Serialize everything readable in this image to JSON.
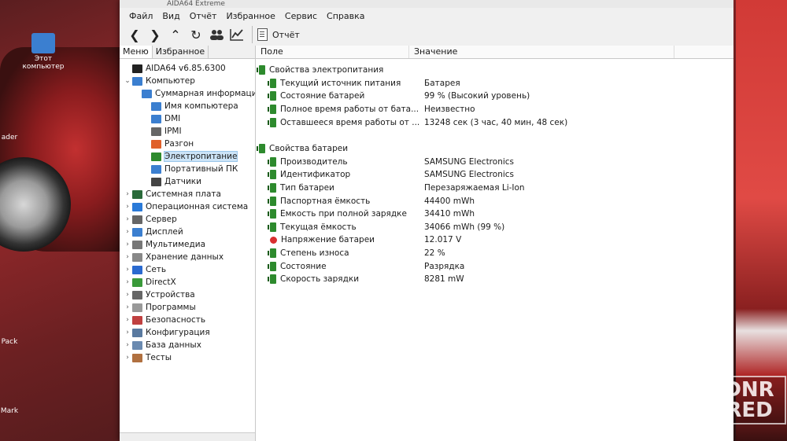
{
  "window": {
    "title": "AIDA64 Extreme",
    "menu": [
      "Файл",
      "Вид",
      "Отчёт",
      "Избранное",
      "Сервис",
      "Справка"
    ],
    "toolbar": {
      "report_label": "Отчёт"
    }
  },
  "left_panel": {
    "tabs": [
      "Меню",
      "Избранное"
    ],
    "tree": [
      {
        "label": "AIDA64 v6.85.6300",
        "icon": "aida64-icon",
        "level": 0,
        "exp": ""
      },
      {
        "label": "Компьютер",
        "icon": "computer-icon",
        "level": 0,
        "exp": "v"
      },
      {
        "label": "Суммарная информация",
        "icon": "monitor-icon",
        "level": 1,
        "exp": ""
      },
      {
        "label": "Имя компьютера",
        "icon": "monitor-icon",
        "level": 1,
        "exp": ""
      },
      {
        "label": "DMI",
        "icon": "monitor-icon",
        "level": 1,
        "exp": ""
      },
      {
        "label": "IPMI",
        "icon": "server-icon",
        "level": 1,
        "exp": ""
      },
      {
        "label": "Разгон",
        "icon": "flame-icon",
        "level": 1,
        "exp": ""
      },
      {
        "label": "Электропитание",
        "icon": "power-icon",
        "level": 1,
        "exp": "",
        "selected": true
      },
      {
        "label": "Портативный ПК",
        "icon": "laptop-icon",
        "level": 1,
        "exp": ""
      },
      {
        "label": "Датчики",
        "icon": "gauge-icon",
        "level": 1,
        "exp": ""
      },
      {
        "label": "Системная плата",
        "icon": "motherboard-icon",
        "level": 0,
        "exp": ">"
      },
      {
        "label": "Операционная система",
        "icon": "windows-icon",
        "level": 0,
        "exp": ">"
      },
      {
        "label": "Сервер",
        "icon": "server-icon",
        "level": 0,
        "exp": ">"
      },
      {
        "label": "Дисплей",
        "icon": "display-icon",
        "level": 0,
        "exp": ">"
      },
      {
        "label": "Мультимедиа",
        "icon": "speaker-icon",
        "level": 0,
        "exp": ">"
      },
      {
        "label": "Хранение данных",
        "icon": "storage-icon",
        "level": 0,
        "exp": ">"
      },
      {
        "label": "Сеть",
        "icon": "network-icon",
        "level": 0,
        "exp": ">"
      },
      {
        "label": "DirectX",
        "icon": "directx-icon",
        "level": 0,
        "exp": ">"
      },
      {
        "label": "Устройства",
        "icon": "devices-icon",
        "level": 0,
        "exp": ">"
      },
      {
        "label": "Программы",
        "icon": "programs-icon",
        "level": 0,
        "exp": ">"
      },
      {
        "label": "Безопасность",
        "icon": "shield-icon",
        "level": 0,
        "exp": ">"
      },
      {
        "label": "Конфигурация",
        "icon": "config-icon",
        "level": 0,
        "exp": ">"
      },
      {
        "label": "База данных",
        "icon": "database-icon",
        "level": 0,
        "exp": ">"
      },
      {
        "label": "Тесты",
        "icon": "tests-icon",
        "level": 0,
        "exp": ">"
      }
    ]
  },
  "right_panel": {
    "columns": [
      "Поле",
      "Значение"
    ],
    "sections": [
      {
        "title": "Свойства электропитания",
        "items": [
          {
            "field": "Текущий источник питания",
            "value": "Батарея",
            "icon": "plug-icon"
          },
          {
            "field": "Состояние батарей",
            "value": "99 % (Высокий уровень)",
            "icon": "plug-icon"
          },
          {
            "field": "Полное время работы от бата...",
            "value": "Неизвестно",
            "icon": "plug-icon"
          },
          {
            "field": "Оставшееся время работы от ...",
            "value": "13248 сек (3 час, 40 мин, 48 сек)",
            "icon": "plug-icon"
          }
        ]
      },
      {
        "title": "Свойства батареи",
        "items": [
          {
            "field": "Производитель",
            "value": "SAMSUNG Electronics",
            "icon": "plug-icon"
          },
          {
            "field": "Идентификатор",
            "value": "SAMSUNG Electronics",
            "icon": "plug-icon"
          },
          {
            "field": "Тип батареи",
            "value": "Перезаряжаемая Li-Ion",
            "icon": "plug-icon"
          },
          {
            "field": "Паспортная ёмкость",
            "value": "44400 mWh",
            "icon": "plug-icon"
          },
          {
            "field": "Ёмкость при полной зарядке",
            "value": "34410 mWh",
            "icon": "plug-icon"
          },
          {
            "field": "Текущая ёмкость",
            "value": "34066 mWh  (99 %)",
            "icon": "plug-icon"
          },
          {
            "field": "Напряжение батареи",
            "value": "12.017 V",
            "icon": "voltage-icon"
          },
          {
            "field": "Степень износа",
            "value": "22 %",
            "icon": "plug-icon"
          },
          {
            "field": "Состояние",
            "value": "Разрядка",
            "icon": "plug-icon"
          },
          {
            "field": "Скорость зарядки",
            "value": "8281 mW",
            "icon": "plug-icon"
          }
        ]
      }
    ]
  },
  "desktop": {
    "icons": [
      "Этот компьютер",
      "ader",
      "Pack",
      "Mark"
    ],
    "watermark": [
      "DNR",
      "RED"
    ]
  },
  "colors": {
    "selection": "#cce4f7",
    "plug": "#2d8a2d"
  }
}
